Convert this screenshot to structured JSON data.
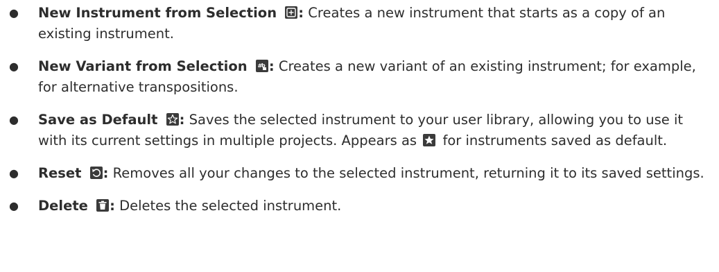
{
  "items": [
    {
      "term": "New Instrument from Selection",
      "icon": "new-instrument-icon",
      "colon": ":",
      "text": " Creates a new instrument that starts as a copy of an existing instrument."
    },
    {
      "term": "New Variant from Selection",
      "icon": "new-variant-icon",
      "colon": ":",
      "text": " Creates a new variant of an existing instrument; for example, for alternative transpositions."
    },
    {
      "term": "Save as Default",
      "icon": "star-outline-icon",
      "colon": ":",
      "text": " Saves the selected instrument to your user library, allowing you to use it with its current settings in multiple projects. Appears as ",
      "inline_icon": "star-filled-icon",
      "text_after": " for instruments saved as default."
    },
    {
      "term": "Reset",
      "icon": "reset-icon",
      "colon": ":",
      "text": " Removes all your changes to the selected instrument, returning it to its saved settings."
    },
    {
      "term": "Delete",
      "icon": "trash-icon",
      "colon": ":",
      "text": " Deletes the selected instrument."
    }
  ],
  "bullet_char": "●",
  "colors": {
    "text": "#2d2d2d",
    "icon_bg": "#3b3b3b",
    "icon_fg": "#ffffff"
  }
}
